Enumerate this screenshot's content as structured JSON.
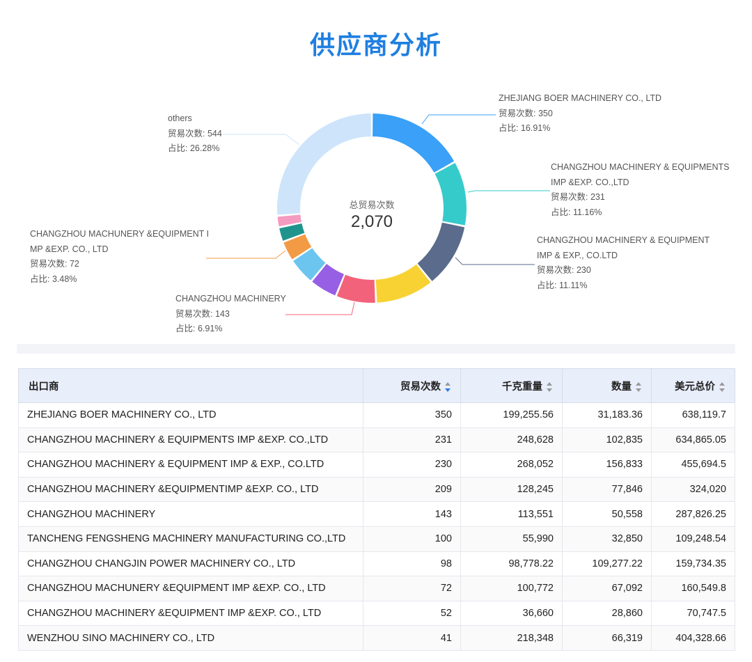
{
  "page_title": "供应商分析",
  "donut": {
    "center_caption": "总贸易次数",
    "center_value": "2,070",
    "labels": [
      {
        "name": "ZHEJIANG BOER MACHINERY CO., LTD",
        "name2": "",
        "count": "贸易次数: 350",
        "pct": "占比: 16.91%"
      },
      {
        "name": "CHANGZHOU MACHINERY & EQUIPMENTS",
        "name2": " IMP &EXP. CO.,LTD",
        "count": "贸易次数: 231",
        "pct": "占比: 11.16%"
      },
      {
        "name": "CHANGZHOU MACHINERY & EQUIPMENT",
        "name2": "IMP & EXP., CO.LTD",
        "count": "贸易次数: 230",
        "pct": "占比: 11.11%"
      },
      {
        "name": "CHANGZHOU MACHINERY",
        "name2": "",
        "count": "贸易次数: 143",
        "pct": "占比: 6.91%"
      },
      {
        "name": "CHANGZHOU MACHUNERY &EQUIPMENT I",
        "name2": "MP &EXP. CO., LTD",
        "count": "贸易次数: 72",
        "pct": "占比: 3.48%"
      },
      {
        "name": "others",
        "name2": "",
        "count": "贸易次数: 544",
        "pct": "占比: 26.28%"
      }
    ]
  },
  "chart_data": {
    "type": "pie",
    "categories": [
      "ZHEJIANG BOER MACHINERY CO., LTD",
      "CHANGZHOU MACHINERY & EQUIPMENTS IMP &EXP. CO.,LTD",
      "CHANGZHOU MACHINERY & EQUIPMENT IMP & EXP., CO.LTD",
      "CHANGZHOU MACHINERY &EQUIPMENTIMP &EXP. CO., LTD",
      "CHANGZHOU MACHINERY",
      "TANCHENG FENGSHENG MACHINERY MANUFACTURING CO.,LTD",
      "CHANGZHOU CHANGJIN POWER MACHINERY CO., LTD",
      "CHANGZHOU MACHUNERY &EQUIPMENT IMP &EXP. CO., LTD",
      "CHANGZHOU MACHINERY &EQUIPMENT IMP &EXP. CO., LTD",
      "WENZHOU SINO MACHINERY CO., LTD",
      "others"
    ],
    "values": [
      350,
      231,
      230,
      209,
      143,
      100,
      98,
      72,
      52,
      41,
      544
    ],
    "colors": [
      "#3aa0f8",
      "#36cbcb",
      "#5a6b8c",
      "#f8d233",
      "#f2637b",
      "#975fe4",
      "#6cc5ee",
      "#f39a45",
      "#1f948c",
      "#f59ac0",
      "#cde4fb"
    ],
    "total": 2070
  },
  "table": {
    "headers": [
      "出口商",
      "贸易次数",
      "千克重量",
      "数量",
      "美元总价"
    ],
    "rows": [
      [
        "ZHEJIANG BOER MACHINERY CO., LTD",
        "350",
        "199,255.56",
        "31,183.36",
        "638,119.7"
      ],
      [
        "CHANGZHOU MACHINERY & EQUIPMENTS IMP &EXP. CO.,LTD",
        "231",
        "248,628",
        "102,835",
        "634,865.05"
      ],
      [
        "CHANGZHOU MACHINERY & EQUIPMENT IMP & EXP., CO.LTD",
        "230",
        "268,052",
        "156,833",
        "455,694.5"
      ],
      [
        "CHANGZHOU MACHINERY &EQUIPMENTIMP &EXP. CO., LTD",
        "209",
        "128,245",
        "77,846",
        "324,020"
      ],
      [
        "CHANGZHOU MACHINERY",
        "143",
        "113,551",
        "50,558",
        "287,826.25"
      ],
      [
        "TANCHENG FENGSHENG MACHINERY MANUFACTURING CO.,LTD",
        "100",
        "55,990",
        "32,850",
        "109,248.54"
      ],
      [
        "CHANGZHOU CHANGJIN POWER MACHINERY CO., LTD",
        "98",
        "98,778.22",
        "109,277.22",
        "159,734.35"
      ],
      [
        "CHANGZHOU MACHUNERY &EQUIPMENT IMP &EXP. CO., LTD",
        "72",
        "100,772",
        "67,092",
        "160,549.8"
      ],
      [
        "CHANGZHOU MACHINERY &EQUIPMENT IMP &EXP. CO., LTD",
        "52",
        "36,660",
        "28,860",
        "70,747.5"
      ],
      [
        "WENZHOU SINO MACHINERY CO., LTD",
        "41",
        "218,348",
        "66,319",
        "404,328.66"
      ]
    ]
  }
}
